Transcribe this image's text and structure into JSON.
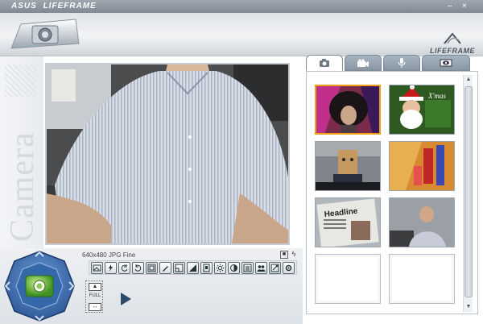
{
  "window": {
    "brand_asus": "ASUS",
    "brand_app": "LIFEFRAME",
    "minimize_label": "–",
    "close_label": "×"
  },
  "header": {
    "logo_text": "LIFEFRAME",
    "icon": "webcam-icon"
  },
  "sidebar": {
    "mode_label": "Camera"
  },
  "preview": {
    "resolution_info": "640x480 JPG Fine"
  },
  "tabs": [
    {
      "icon": "camera-icon",
      "active": true
    },
    {
      "icon": "video-camera-icon",
      "active": false
    },
    {
      "icon": "microphone-icon",
      "active": false
    },
    {
      "icon": "eye-icon",
      "active": false
    }
  ],
  "gallery": {
    "headline_text": "Headline",
    "thumbs": [
      {
        "name": "thumb-wild-hair",
        "selected": true
      },
      {
        "name": "thumb-santa-xmas",
        "selected": false,
        "label": "X'mas"
      },
      {
        "name": "thumb-paper-bag",
        "selected": false
      },
      {
        "name": "thumb-abstract",
        "selected": false
      },
      {
        "name": "thumb-newspaper",
        "selected": false
      },
      {
        "name": "thumb-man-office",
        "selected": false
      },
      {
        "name": "thumb-empty-1",
        "empty": true
      },
      {
        "name": "thumb-empty-2",
        "empty": true
      }
    ]
  },
  "controls": {
    "size_label": "FULL",
    "toolbar_icons": [
      "image-icon",
      "flash-icon",
      "rotate-left-icon",
      "rotate-right-icon",
      "frame-icon",
      "pen-icon",
      "frame-border-icon",
      "crop-icon",
      "frame-select-icon",
      "brightness-icon",
      "contrast-icon",
      "list-icon",
      "people-icon",
      "effects-icon",
      "settings-icon"
    ]
  },
  "colors": {
    "accent_green": "#5cb830",
    "nav_blue": "#3c6fb0",
    "selected_border": "#f0a020"
  }
}
